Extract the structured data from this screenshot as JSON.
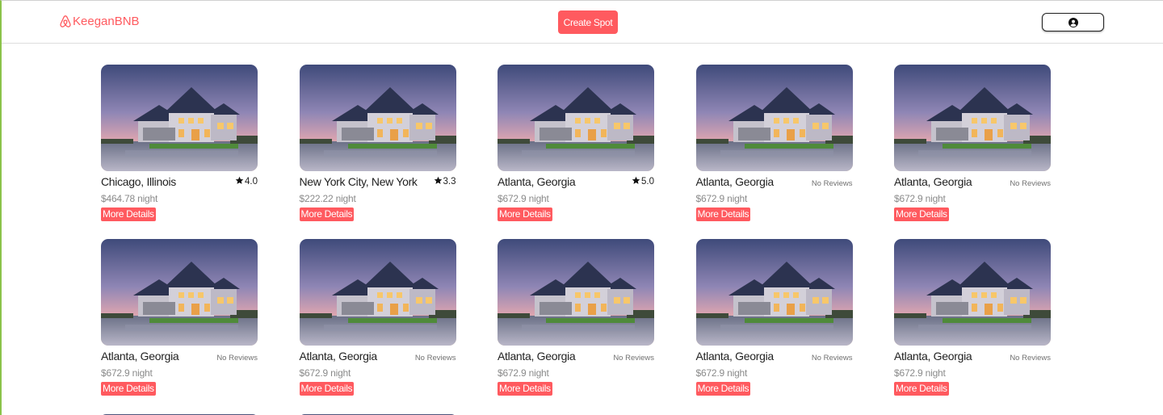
{
  "brand": {
    "name": "KeeganBNB",
    "color": "#ff5a5f",
    "icon": "airbnb-logo-icon"
  },
  "header": {
    "create_spot_label": "Create Spot",
    "profile_icon": "user-circle-icon"
  },
  "spots": [
    {
      "city": "Chicago, Illinois",
      "rating": "4.0",
      "price": "$464.78 night",
      "details_label": "More Details"
    },
    {
      "city": "New York City, New York",
      "rating": "3.3",
      "price": "$222.22 night",
      "details_label": "More Details"
    },
    {
      "city": "Atlanta, Georgia",
      "rating": "5.0",
      "price": "$672.9 night",
      "details_label": "More Details"
    },
    {
      "city": "Atlanta, Georgia",
      "no_reviews": "No Reviews",
      "price": "$672.9 night",
      "details_label": "More Details"
    },
    {
      "city": "Atlanta, Georgia",
      "no_reviews": "No Reviews",
      "price": "$672.9 night",
      "details_label": "More Details"
    },
    {
      "city": "Atlanta, Georgia",
      "no_reviews": "No Reviews",
      "price": "$672.9 night",
      "details_label": "More Details"
    },
    {
      "city": "Atlanta, Georgia",
      "no_reviews": "No Reviews",
      "price": "$672.9 night",
      "details_label": "More Details"
    },
    {
      "city": "Atlanta, Georgia",
      "no_reviews": "No Reviews",
      "price": "$672.9 night",
      "details_label": "More Details"
    },
    {
      "city": "Atlanta, Georgia",
      "no_reviews": "No Reviews",
      "price": "$672.9 night",
      "details_label": "More Details"
    },
    {
      "city": "Atlanta, Georgia",
      "no_reviews": "No Reviews",
      "price": "$672.9 night",
      "details_label": "More Details"
    }
  ],
  "colors": {
    "accent": "#ff5a5f",
    "text": "#222222",
    "muted": "#8a8a8a"
  }
}
